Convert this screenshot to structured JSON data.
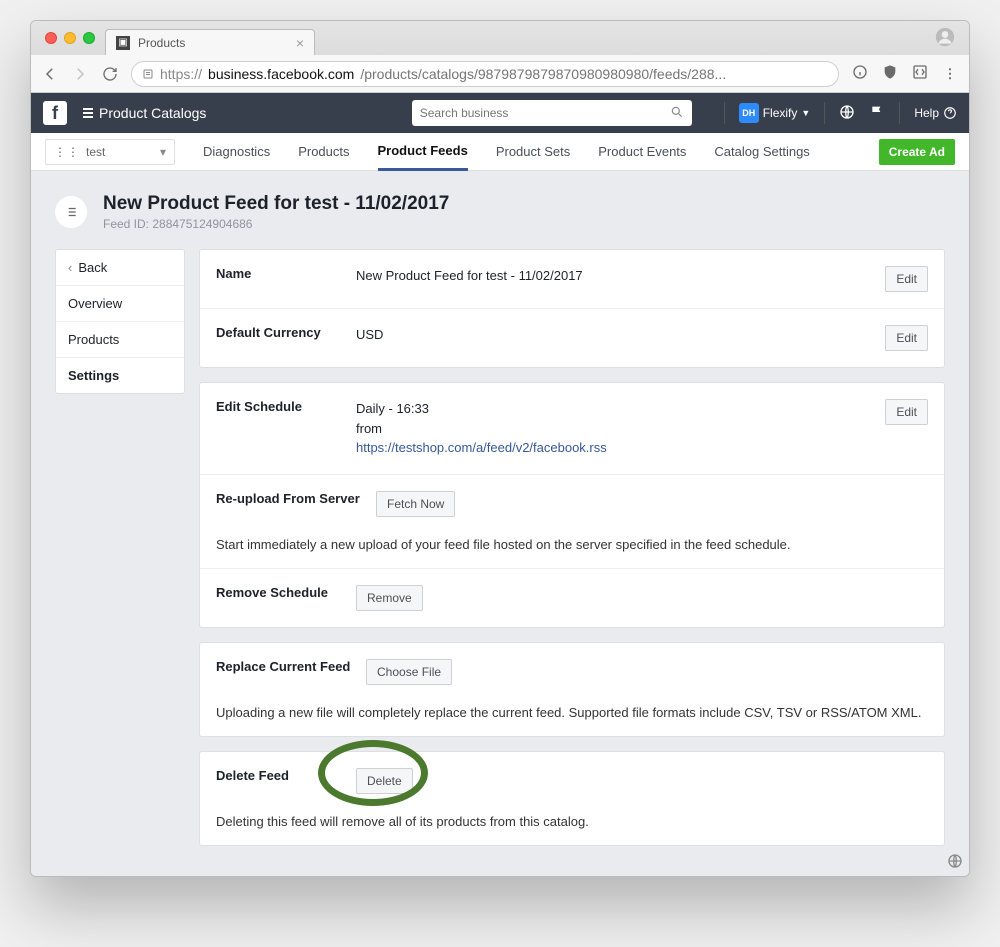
{
  "browser": {
    "tab_title": "Products",
    "url_protocol": "https://",
    "url_host": "business.facebook.com",
    "url_path": "/products/catalogs/98798798798709809809​80/feeds/288..."
  },
  "fb_header": {
    "section": "Product Catalogs",
    "search_placeholder": "Search business",
    "account_label": "Flexify",
    "avatar_initials": "DH",
    "help_label": "Help"
  },
  "subnav": {
    "catalog_name": "test",
    "tabs": {
      "diagnostics": "Diagnostics",
      "products": "Products",
      "product_feeds": "Product Feeds",
      "product_sets": "Product Sets",
      "product_events": "Product Events",
      "catalog_settings": "Catalog Settings"
    },
    "create_ad": "Create Ad"
  },
  "page": {
    "title": "New Product Feed for test - 11/02/2017",
    "feed_id_label": "Feed ID: 288475124904686"
  },
  "sidebar": {
    "back": "Back",
    "items": {
      "overview": "Overview",
      "products": "Products",
      "settings": "Settings"
    }
  },
  "settings": {
    "name": {
      "label": "Name",
      "value": "New Product Feed for test - 11/02/2017",
      "edit": "Edit"
    },
    "currency": {
      "label": "Default Currency",
      "value": "USD",
      "edit": "Edit"
    },
    "schedule": {
      "label": "Edit Schedule",
      "freq": "Daily - 16:33",
      "from": "from",
      "url": "https://testshop.com/a/feed/v2/facebook.rss",
      "edit": "Edit"
    },
    "reupload": {
      "label": "Re-upload From Server",
      "button": "Fetch Now",
      "note": "Start immediately a new upload of your feed file hosted on the server specified in the feed schedule."
    },
    "remove_schedule": {
      "label": "Remove Schedule",
      "button": "Remove"
    },
    "replace": {
      "label": "Replace Current Feed",
      "button": "Choose File",
      "note": "Uploading a new file will completely replace the current feed. Supported file formats include CSV, TSV or RSS/ATOM XML."
    },
    "delete": {
      "label": "Delete Feed",
      "button": "Delete",
      "note": "Deleting this feed will remove all of its products from this catalog."
    }
  }
}
